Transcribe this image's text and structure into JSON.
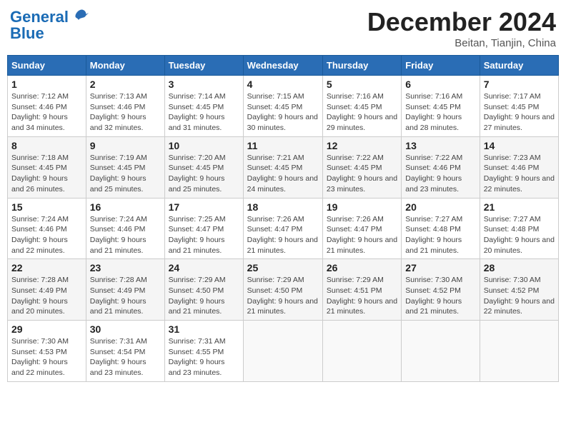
{
  "header": {
    "logo_line1": "General",
    "logo_line2": "Blue",
    "month": "December 2024",
    "location": "Beitan, Tianjin, China"
  },
  "weekdays": [
    "Sunday",
    "Monday",
    "Tuesday",
    "Wednesday",
    "Thursday",
    "Friday",
    "Saturday"
  ],
  "weeks": [
    [
      {
        "day": "1",
        "sunrise": "7:12 AM",
        "sunset": "4:46 PM",
        "daylight": "9 hours and 34 minutes."
      },
      {
        "day": "2",
        "sunrise": "7:13 AM",
        "sunset": "4:46 PM",
        "daylight": "9 hours and 32 minutes."
      },
      {
        "day": "3",
        "sunrise": "7:14 AM",
        "sunset": "4:45 PM",
        "daylight": "9 hours and 31 minutes."
      },
      {
        "day": "4",
        "sunrise": "7:15 AM",
        "sunset": "4:45 PM",
        "daylight": "9 hours and 30 minutes."
      },
      {
        "day": "5",
        "sunrise": "7:16 AM",
        "sunset": "4:45 PM",
        "daylight": "9 hours and 29 minutes."
      },
      {
        "day": "6",
        "sunrise": "7:16 AM",
        "sunset": "4:45 PM",
        "daylight": "9 hours and 28 minutes."
      },
      {
        "day": "7",
        "sunrise": "7:17 AM",
        "sunset": "4:45 PM",
        "daylight": "9 hours and 27 minutes."
      }
    ],
    [
      {
        "day": "8",
        "sunrise": "7:18 AM",
        "sunset": "4:45 PM",
        "daylight": "9 hours and 26 minutes."
      },
      {
        "day": "9",
        "sunrise": "7:19 AM",
        "sunset": "4:45 PM",
        "daylight": "9 hours and 25 minutes."
      },
      {
        "day": "10",
        "sunrise": "7:20 AM",
        "sunset": "4:45 PM",
        "daylight": "9 hours and 25 minutes."
      },
      {
        "day": "11",
        "sunrise": "7:21 AM",
        "sunset": "4:45 PM",
        "daylight": "9 hours and 24 minutes."
      },
      {
        "day": "12",
        "sunrise": "7:22 AM",
        "sunset": "4:45 PM",
        "daylight": "9 hours and 23 minutes."
      },
      {
        "day": "13",
        "sunrise": "7:22 AM",
        "sunset": "4:46 PM",
        "daylight": "9 hours and 23 minutes."
      },
      {
        "day": "14",
        "sunrise": "7:23 AM",
        "sunset": "4:46 PM",
        "daylight": "9 hours and 22 minutes."
      }
    ],
    [
      {
        "day": "15",
        "sunrise": "7:24 AM",
        "sunset": "4:46 PM",
        "daylight": "9 hours and 22 minutes."
      },
      {
        "day": "16",
        "sunrise": "7:24 AM",
        "sunset": "4:46 PM",
        "daylight": "9 hours and 21 minutes."
      },
      {
        "day": "17",
        "sunrise": "7:25 AM",
        "sunset": "4:47 PM",
        "daylight": "9 hours and 21 minutes."
      },
      {
        "day": "18",
        "sunrise": "7:26 AM",
        "sunset": "4:47 PM",
        "daylight": "9 hours and 21 minutes."
      },
      {
        "day": "19",
        "sunrise": "7:26 AM",
        "sunset": "4:47 PM",
        "daylight": "9 hours and 21 minutes."
      },
      {
        "day": "20",
        "sunrise": "7:27 AM",
        "sunset": "4:48 PM",
        "daylight": "9 hours and 21 minutes."
      },
      {
        "day": "21",
        "sunrise": "7:27 AM",
        "sunset": "4:48 PM",
        "daylight": "9 hours and 20 minutes."
      }
    ],
    [
      {
        "day": "22",
        "sunrise": "7:28 AM",
        "sunset": "4:49 PM",
        "daylight": "9 hours and 20 minutes."
      },
      {
        "day": "23",
        "sunrise": "7:28 AM",
        "sunset": "4:49 PM",
        "daylight": "9 hours and 21 minutes."
      },
      {
        "day": "24",
        "sunrise": "7:29 AM",
        "sunset": "4:50 PM",
        "daylight": "9 hours and 21 minutes."
      },
      {
        "day": "25",
        "sunrise": "7:29 AM",
        "sunset": "4:50 PM",
        "daylight": "9 hours and 21 minutes."
      },
      {
        "day": "26",
        "sunrise": "7:29 AM",
        "sunset": "4:51 PM",
        "daylight": "9 hours and 21 minutes."
      },
      {
        "day": "27",
        "sunrise": "7:30 AM",
        "sunset": "4:52 PM",
        "daylight": "9 hours and 21 minutes."
      },
      {
        "day": "28",
        "sunrise": "7:30 AM",
        "sunset": "4:52 PM",
        "daylight": "9 hours and 22 minutes."
      }
    ],
    [
      {
        "day": "29",
        "sunrise": "7:30 AM",
        "sunset": "4:53 PM",
        "daylight": "9 hours and 22 minutes."
      },
      {
        "day": "30",
        "sunrise": "7:31 AM",
        "sunset": "4:54 PM",
        "daylight": "9 hours and 23 minutes."
      },
      {
        "day": "31",
        "sunrise": "7:31 AM",
        "sunset": "4:55 PM",
        "daylight": "9 hours and 23 minutes."
      },
      null,
      null,
      null,
      null
    ]
  ]
}
